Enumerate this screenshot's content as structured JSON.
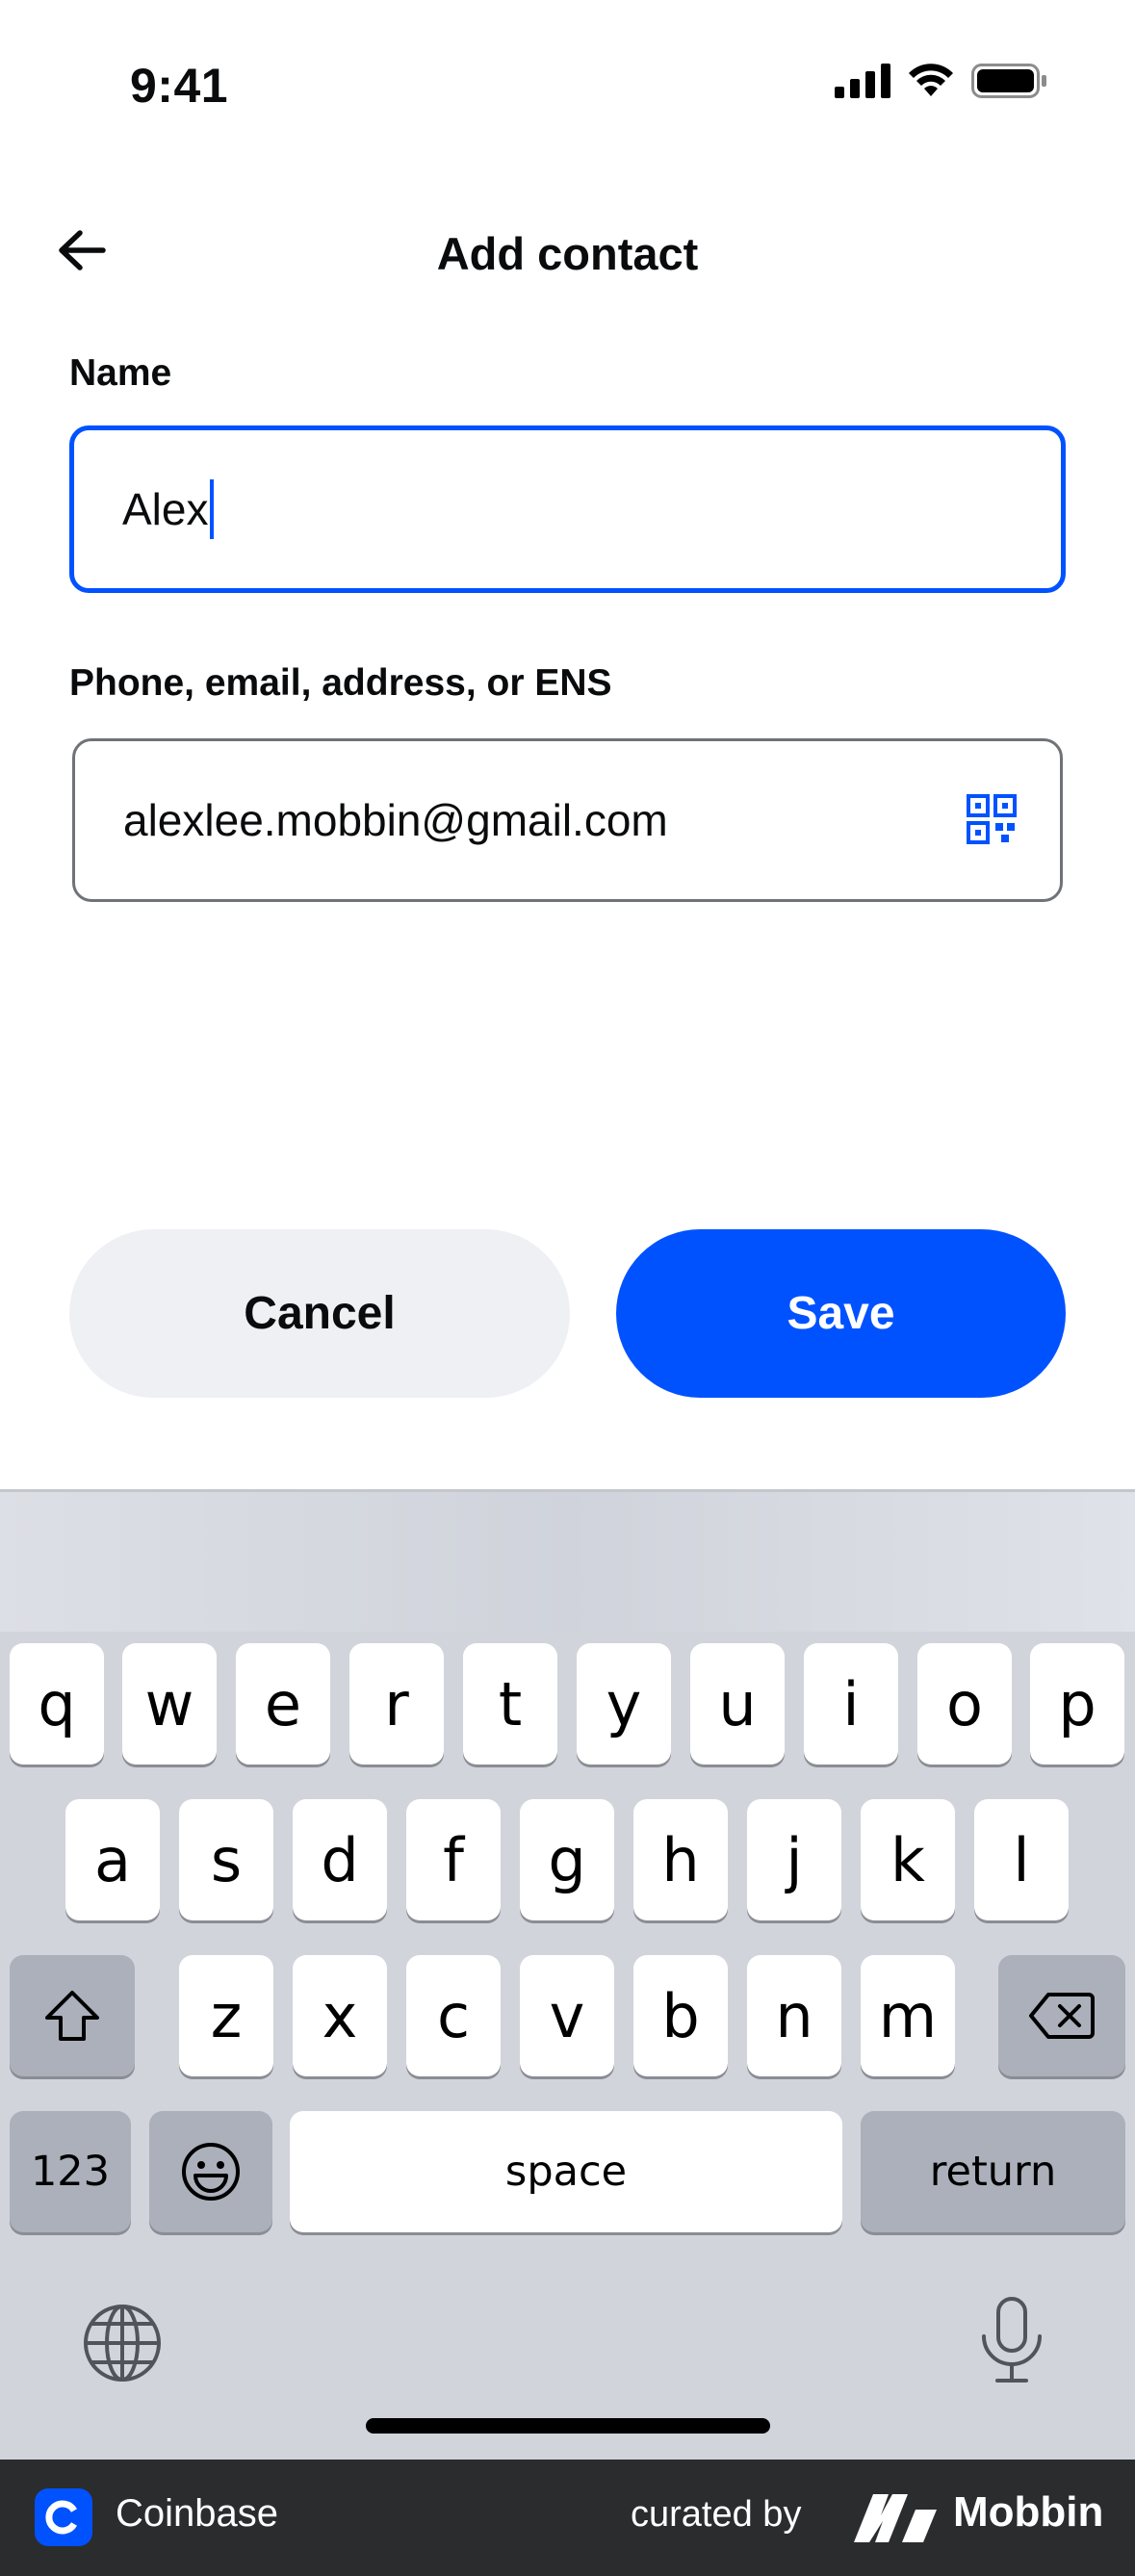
{
  "status_bar": {
    "time": "9:41"
  },
  "header": {
    "title": "Add contact",
    "back_icon": "arrow-left-icon"
  },
  "form": {
    "name_label": "Name",
    "name_value": "Alex",
    "address_label": "Phone, email, address, or ENS",
    "address_value": "alexlee.mobbin@gmail.com",
    "qr_icon": "qr-code-icon"
  },
  "buttons": {
    "cancel": "Cancel",
    "save": "Save"
  },
  "keyboard": {
    "row1": [
      "q",
      "w",
      "e",
      "r",
      "t",
      "y",
      "u",
      "i",
      "o",
      "p"
    ],
    "row2": [
      "a",
      "s",
      "d",
      "f",
      "g",
      "h",
      "j",
      "k",
      "l"
    ],
    "row3": [
      "z",
      "x",
      "c",
      "v",
      "b",
      "n",
      "m"
    ],
    "numbers_key": "123",
    "space_key": "space",
    "return_key": "return"
  },
  "footer": {
    "app_name": "Coinbase",
    "curated_by": "curated by",
    "brand": "Mobbin"
  },
  "colors": {
    "accent": "#0052ff",
    "cancel_bg": "#eef0f3",
    "footer_bg": "#2b2c2e"
  }
}
